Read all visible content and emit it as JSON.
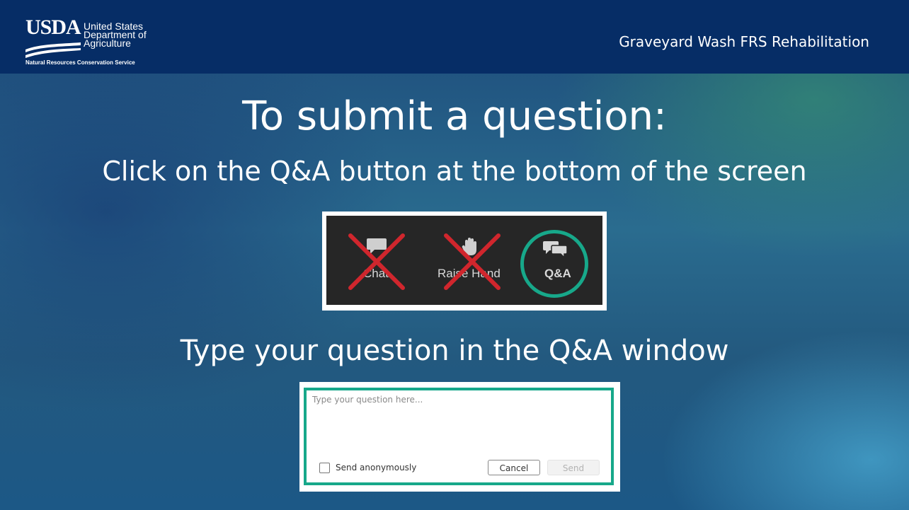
{
  "header": {
    "logo": {
      "mark": "USDA",
      "line1": "United States",
      "line2": "Department of",
      "line3": "Agriculture",
      "agency": "Natural Resources Conservation Service"
    },
    "title": "Graveyard Wash FRS Rehabilitation"
  },
  "main": {
    "title": "To submit a question:",
    "subtitle": "Click on the Q&A button at the bottom of the screen",
    "toolbar": {
      "buttons": [
        {
          "label": "Chat",
          "icon": "chat-icon",
          "crossed_out": true
        },
        {
          "label": "Raise Hand",
          "icon": "raise-hand-icon",
          "crossed_out": true
        },
        {
          "label": "Q&A",
          "icon": "qa-icon",
          "highlighted": true
        }
      ]
    },
    "section2_title": "Type your question in the Q&A window",
    "qa_window": {
      "placeholder": "Type your question here...",
      "anonymous_label": "Send anonymously",
      "cancel_label": "Cancel",
      "send_label": "Send"
    }
  },
  "colors": {
    "header_bg": "#062d66",
    "highlight": "#17a88a",
    "cross": "#d0262d"
  }
}
